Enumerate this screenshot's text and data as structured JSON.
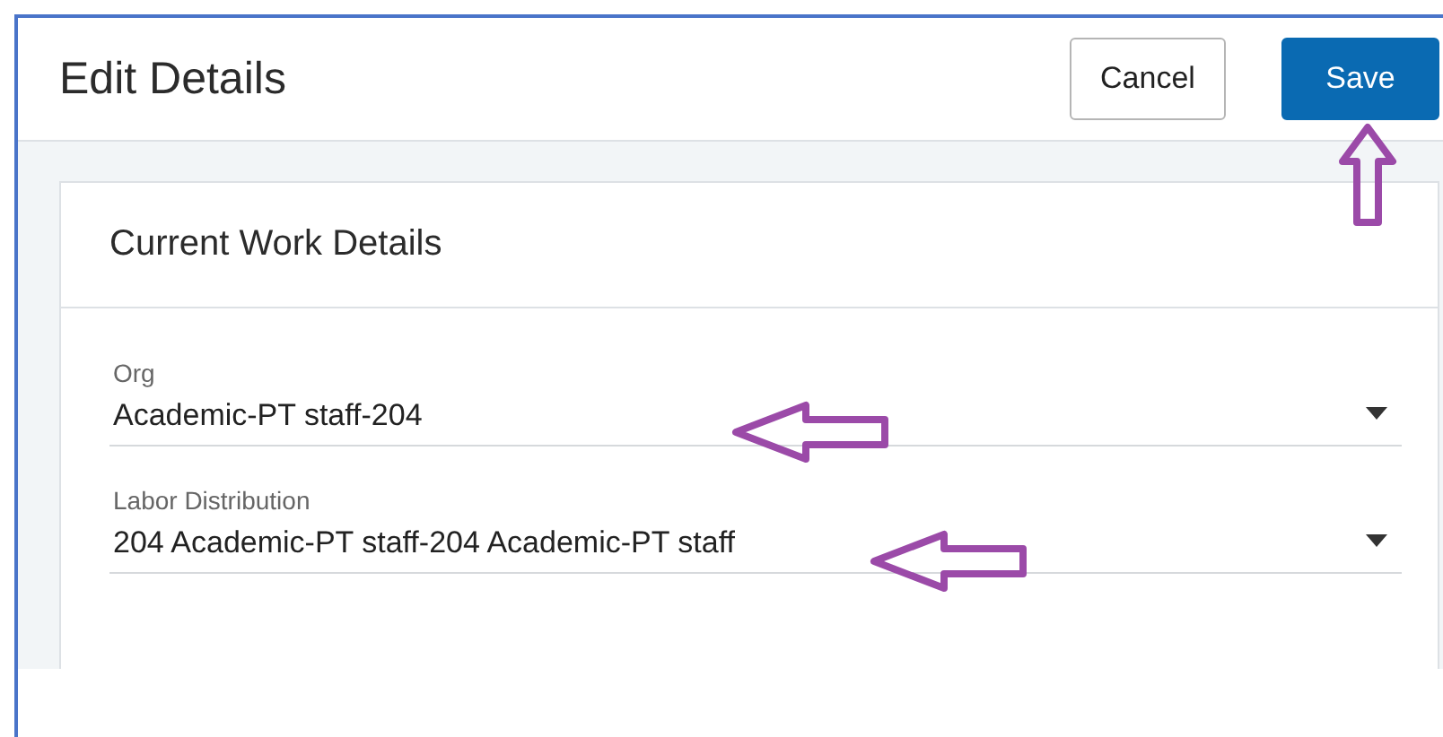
{
  "header": {
    "title": "Edit Details",
    "buttons": [
      {
        "label": "Cancel",
        "kind": "secondary"
      },
      {
        "label": "Save",
        "kind": "primary"
      }
    ]
  },
  "card": {
    "title": "Current Work Details",
    "fields": [
      {
        "label": "Org",
        "value": "Academic-PT staff-204"
      },
      {
        "label": "Labor Distribution",
        "value": "204 Academic-PT staff-204 Academic-PT staff"
      }
    ]
  }
}
